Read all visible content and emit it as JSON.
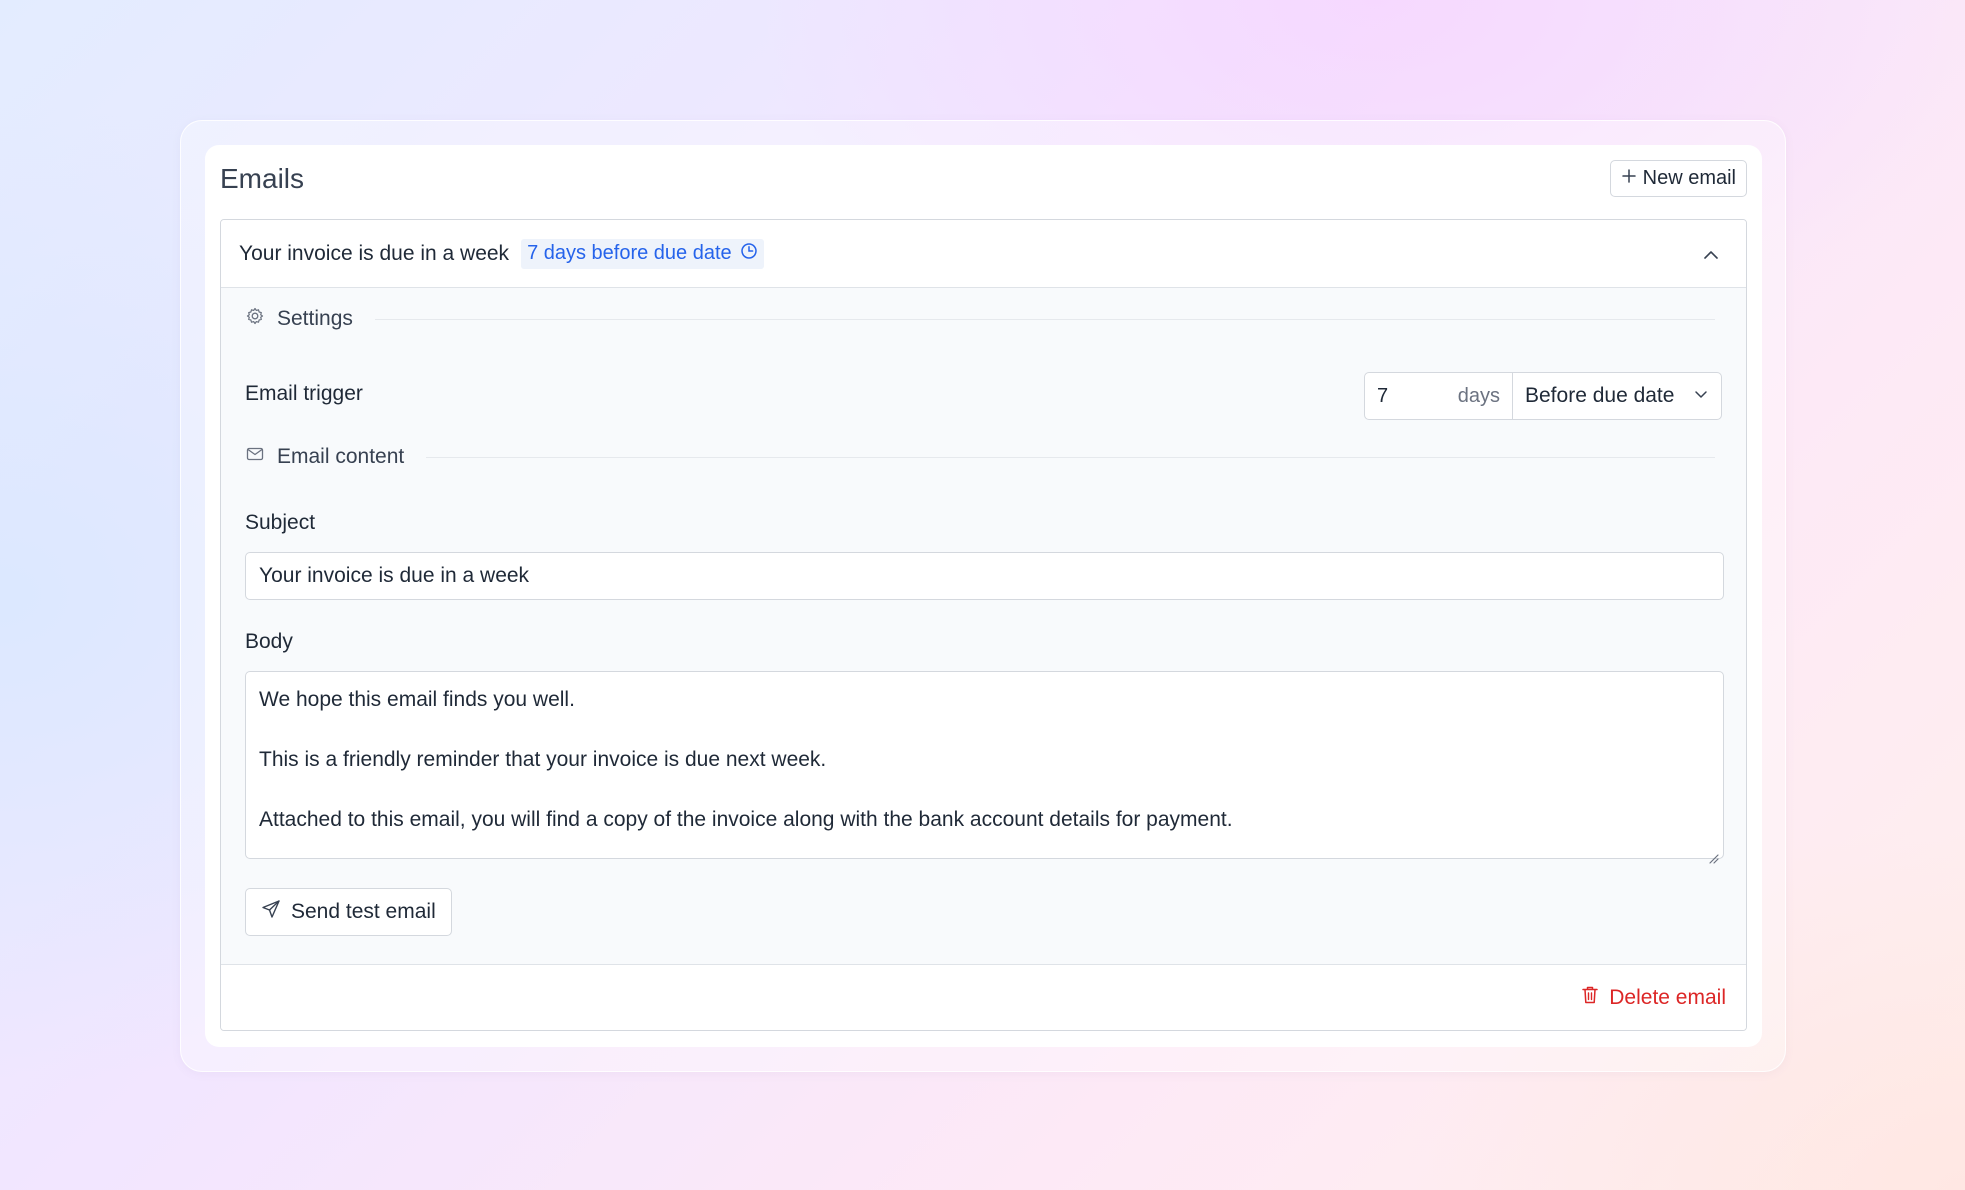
{
  "card": {
    "title": "Emails",
    "new_button_label": "New email"
  },
  "email": {
    "title": "Your invoice is due in a week",
    "badge": "7 days before due date"
  },
  "settings": {
    "section_label": "Settings"
  },
  "trigger": {
    "label": "Email trigger",
    "days_value": "7",
    "days_unit": "days",
    "timing_selected": "Before due date"
  },
  "content": {
    "section_label": "Email content",
    "subject_label": "Subject",
    "subject_value": "Your invoice is due in a week",
    "body_label": "Body",
    "body_lines": [
      "We hope this email finds you well.",
      "",
      "This is a friendly reminder that your invoice is due next week.",
      "",
      "Attached to this email, you will find a copy of the invoice along with the bank account details for payment."
    ]
  },
  "actions": {
    "send_test_label": "Send test email",
    "delete_label": "Delete email"
  },
  "colors": {
    "accent": "#2563eb",
    "danger": "#dc2626",
    "badge_bg": "#eef3fb"
  }
}
